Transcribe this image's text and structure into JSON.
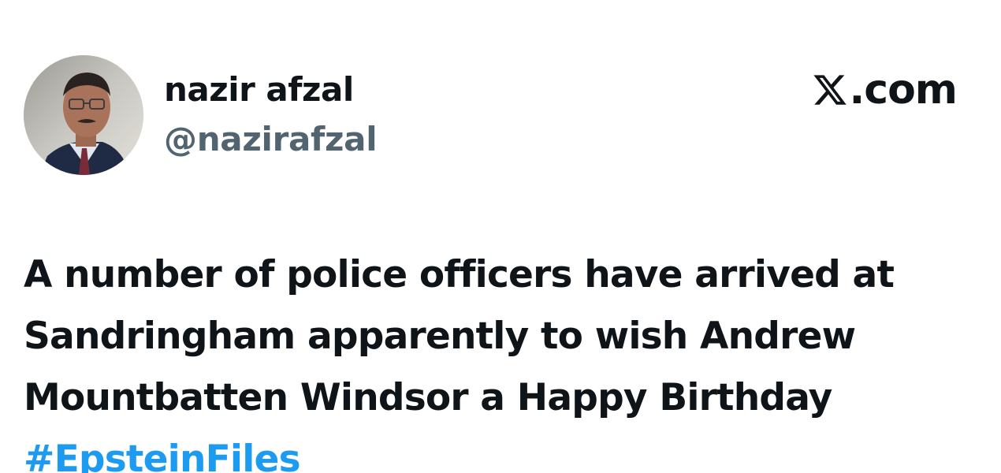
{
  "author": {
    "display_name": "nazir afzal",
    "handle": "@nazirafzal"
  },
  "brand": {
    "x_glyph": "X",
    "domain_suffix": ".com"
  },
  "tweet": {
    "lines": [
      "A number of police officers have arrived at",
      "Sandringham apparently to wish Andrew",
      "Mountbatten Windsor a Happy Birthday"
    ],
    "hashtag": "#EpsteinFiles"
  },
  "colors": {
    "text_primary": "#0f1419",
    "text_secondary": "#536471",
    "link": "#1d9bf0"
  },
  "icons": {
    "avatar": "profile-photo",
    "brand": "x-logo"
  }
}
